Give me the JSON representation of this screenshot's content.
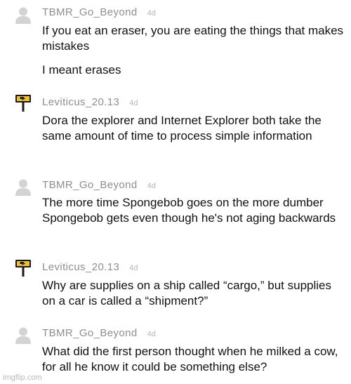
{
  "comments": [
    {
      "username": "TBMR_Go_Beyond",
      "time": "4d",
      "avatar": "default-user-icon",
      "paragraphs": [
        "If you eat an eraser, you are eating the things that makes mistakes",
        "I meant erases"
      ]
    },
    {
      "username": "Leviticus_20.13",
      "time": "4d",
      "avatar": "lightning-sign-icon",
      "paragraphs": [
        "Dora the explorer and Internet Explorer both take the same amount of time to process simple information"
      ]
    },
    {
      "username": "TBMR_Go_Beyond",
      "time": "4d",
      "avatar": "default-user-icon",
      "paragraphs": [
        "The more time Spongebob goes on the more dumber Spongebob gets even though he's not aging backwards"
      ]
    },
    {
      "username": "Leviticus_20.13",
      "time": "4d",
      "avatar": "lightning-sign-icon",
      "paragraphs": [
        "Why are supplies on a ship called “cargo,” but supplies on a car is called a “shipment?”"
      ]
    },
    {
      "username": "TBMR_Go_Beyond",
      "time": "4d",
      "avatar": "default-user-icon",
      "paragraphs": [
        "What did the first person thought when he milked a cow, for all he know it could be something else?"
      ]
    }
  ],
  "watermark": "imgflip.com",
  "colors": {
    "username": "#8e8e8e",
    "time": "#b6b6b6",
    "text": "#111111",
    "avatar_gray": "#d3d3d3",
    "sign_yellow": "#f2c12e",
    "sign_dark": "#1a1a1a"
  }
}
